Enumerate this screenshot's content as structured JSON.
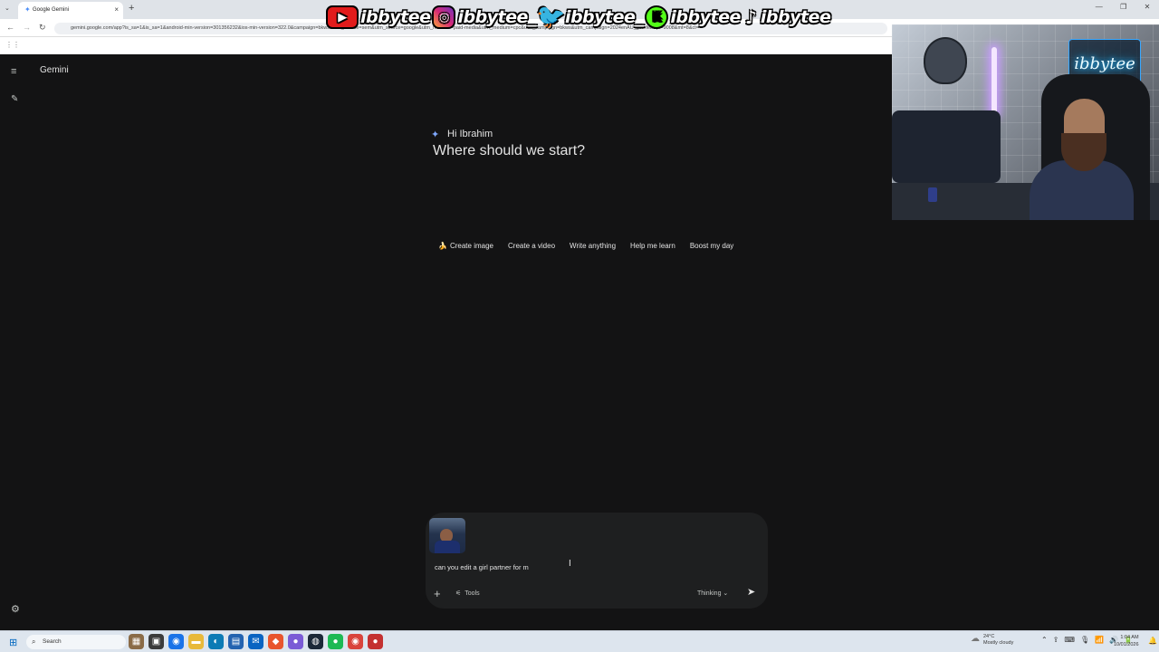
{
  "browser": {
    "tab_title": "Google Gemini",
    "tab_close": "×",
    "tab_menu": "⌄",
    "new_tab": "+",
    "window_controls": [
      "—",
      "❐",
      "✕"
    ],
    "url": "gemini.google.com/app?is_sa=1&is_sa=1&android-min-version=301356232&ios-min-version=322.0&campaign=bkws&utm_source=sem&utm_source=google&utm_medium=paid-media&utm_medium=cpc&utm_campaign=bkws&utm_campaign=2024enAU_gemfeb&pt=9008&mt=8&ct=",
    "nav_back": "←",
    "nav_forward": "→",
    "nav_reload": "↻",
    "apps_icon": "⋮⋮"
  },
  "social_overlay": {
    "handles": [
      {
        "platform": "youtube",
        "icon": "▶",
        "handle": "ibbytee"
      },
      {
        "platform": "instagram",
        "icon": "◎",
        "handle": "ibbytee_"
      },
      {
        "platform": "twitter",
        "icon": "🐦",
        "handle": "ibbytee_"
      },
      {
        "platform": "kick",
        "icon": "K",
        "handle": "ibbytee"
      },
      {
        "platform": "tiktok",
        "icon": "♪",
        "handle": "ibbytee"
      }
    ]
  },
  "gemini": {
    "brand": "Gemini",
    "menu_icon": "≡",
    "new_chat_icon": "✎",
    "settings_icon": "⚙",
    "sparkle": "✦",
    "greeting": "Hi Ibrahim",
    "headline": "Where should we start?",
    "chips": [
      {
        "icon": "🍌",
        "label": "Create image"
      },
      {
        "icon": "",
        "label": "Create a video"
      },
      {
        "icon": "",
        "label": "Write anything"
      },
      {
        "icon": "",
        "label": "Help me learn"
      },
      {
        "icon": "",
        "label": "Boost my day"
      }
    ],
    "composer": {
      "prompt_text": "can you edit a girl partner for m",
      "plus_icon": "+",
      "tools_icon": "⚟",
      "tools_label": "Tools",
      "mode_label": "Thinking",
      "mode_chevron": "⌄",
      "send_icon": "➤"
    }
  },
  "webcam": {
    "neon_sign": "ibbytee"
  },
  "taskbar": {
    "start_icon": "⊞",
    "search_icon": "⌕",
    "search_placeholder": "Search",
    "apps": [
      {
        "name": "widgets",
        "glyph": "▦",
        "color": "#8a6b47"
      },
      {
        "name": "task-view",
        "glyph": "▣",
        "color": "#3c3c3c"
      },
      {
        "name": "chrome",
        "glyph": "◉",
        "color": "#1a73e8"
      },
      {
        "name": "file-explorer",
        "glyph": "▬",
        "color": "#e8b93a"
      },
      {
        "name": "edge",
        "glyph": "◐",
        "color": "#0c7bb5"
      },
      {
        "name": "store",
        "glyph": "▤",
        "color": "#2463b0"
      },
      {
        "name": "outlook",
        "glyph": "✉",
        "color": "#0a64c2"
      },
      {
        "name": "brave",
        "glyph": "◆",
        "color": "#e8552d"
      },
      {
        "name": "app-purple",
        "glyph": "●",
        "color": "#7b5bd6"
      },
      {
        "name": "steam",
        "glyph": "◍",
        "color": "#1b2838"
      },
      {
        "name": "spotify",
        "glyph": "●",
        "color": "#1db954"
      },
      {
        "name": "chrome-alt",
        "glyph": "◉",
        "color": "#d9443c"
      },
      {
        "name": "recorder",
        "glyph": "●",
        "color": "#c43131"
      }
    ],
    "weather_temp": "24°C",
    "weather_desc": "Mostly cloudy",
    "tray_icons": [
      "⌃",
      "⇪",
      "⌨",
      "🎙",
      "📶",
      "🔊",
      "🔋"
    ],
    "time": "1:04 AM",
    "date": "10/01/2026",
    "notification_icon": "🔔"
  }
}
